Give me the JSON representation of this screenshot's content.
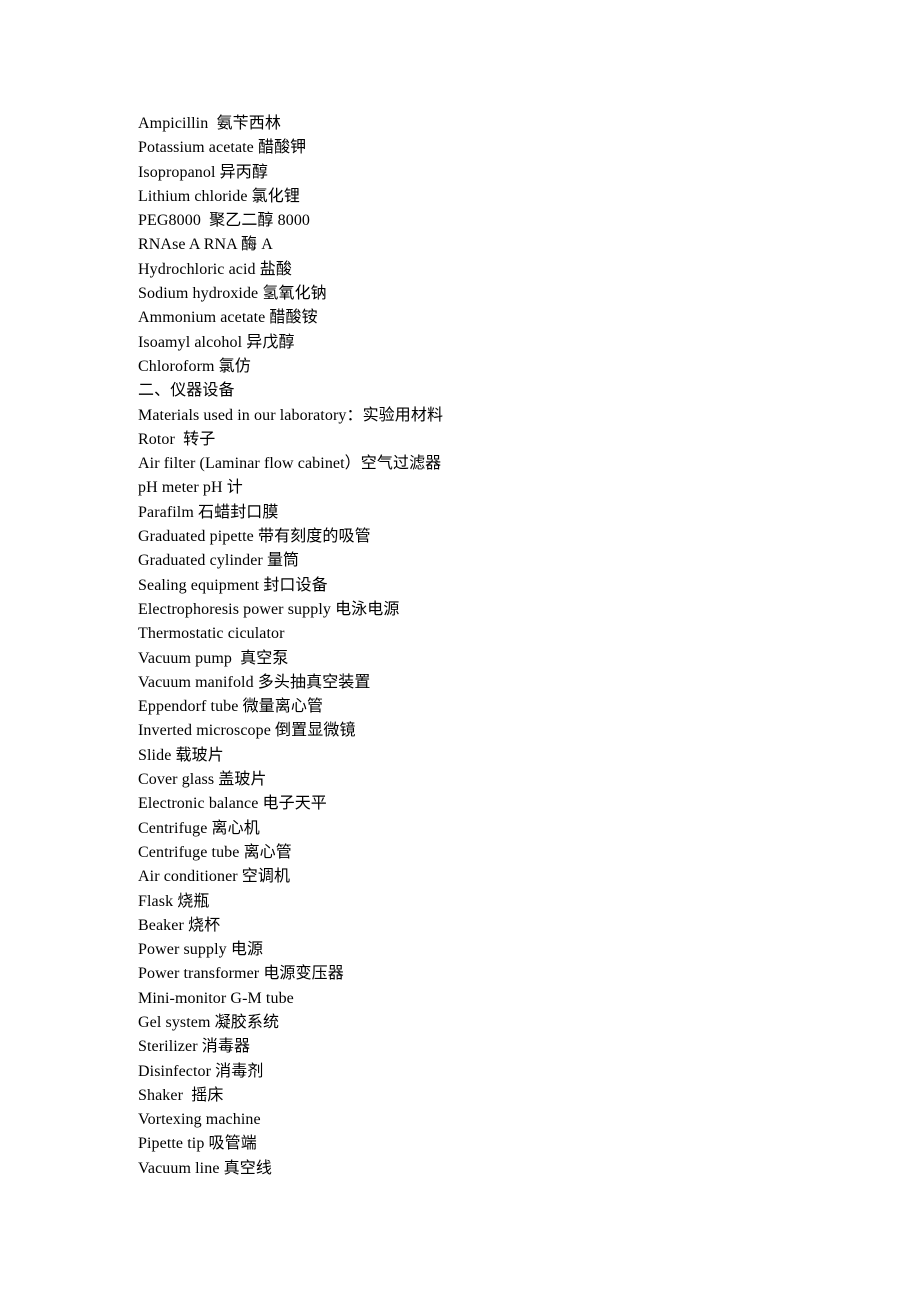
{
  "document": {
    "background_color": "#ffffff",
    "text_color": "#000000",
    "lines": [
      {
        "text": "Ampicillin  氨苄西林",
        "type": "entry"
      },
      {
        "text": "Potassium acetate 醋酸钾",
        "type": "entry"
      },
      {
        "text": "Isopropanol 异丙醇",
        "type": "entry"
      },
      {
        "text": "Lithium chloride 氯化锂",
        "type": "entry"
      },
      {
        "text": "PEG8000  聚乙二醇 8000",
        "type": "entry"
      },
      {
        "text": "RNAse A RNA 酶 A",
        "type": "entry"
      },
      {
        "text": "Hydrochloric acid 盐酸",
        "type": "entry"
      },
      {
        "text": "Sodium hydroxide 氢氧化钠",
        "type": "entry"
      },
      {
        "text": "Ammonium acetate 醋酸铵",
        "type": "entry"
      },
      {
        "text": "Isoamyl alcohol 异戊醇",
        "type": "entry"
      },
      {
        "text": "Chloroform 氯仿",
        "type": "entry"
      },
      {
        "text": "二、仪器设备",
        "type": "heading"
      },
      {
        "text": "Materials used in our laboratory：实验用材料",
        "type": "entry"
      },
      {
        "text": "Rotor  转子",
        "type": "entry"
      },
      {
        "text": "Air filter (Laminar flow cabinet）空气过滤器",
        "type": "entry"
      },
      {
        "text": "pH meter pH 计",
        "type": "entry"
      },
      {
        "text": "Parafilm 石蜡封口膜",
        "type": "entry"
      },
      {
        "text": "Graduated pipette 带有刻度的吸管",
        "type": "entry"
      },
      {
        "text": "Graduated cylinder 量筒",
        "type": "entry"
      },
      {
        "text": "Sealing equipment 封口设备",
        "type": "entry"
      },
      {
        "text": "Electrophoresis power supply 电泳电源",
        "type": "entry"
      },
      {
        "text": "Thermostatic ciculator",
        "type": "entry"
      },
      {
        "text": "Vacuum pump  真空泵",
        "type": "entry"
      },
      {
        "text": "Vacuum manifold 多头抽真空装置",
        "type": "entry"
      },
      {
        "text": "Eppendorf tube 微量离心管",
        "type": "entry"
      },
      {
        "text": "Inverted microscope 倒置显微镜",
        "type": "entry"
      },
      {
        "text": "Slide 载玻片",
        "type": "entry"
      },
      {
        "text": "Cover glass 盖玻片",
        "type": "entry"
      },
      {
        "text": "Electronic balance 电子天平",
        "type": "entry"
      },
      {
        "text": "Centrifuge 离心机",
        "type": "entry"
      },
      {
        "text": "Centrifuge tube 离心管",
        "type": "entry"
      },
      {
        "text": "Air conditioner 空调机",
        "type": "entry"
      },
      {
        "text": "Flask 烧瓶",
        "type": "entry"
      },
      {
        "text": "Beaker 烧杯",
        "type": "entry"
      },
      {
        "text": "Power supply 电源",
        "type": "entry"
      },
      {
        "text": "Power transformer 电源变压器",
        "type": "entry"
      },
      {
        "text": "Mini-monitor G-M tube",
        "type": "entry"
      },
      {
        "text": "Gel system 凝胶系统",
        "type": "entry"
      },
      {
        "text": "Sterilizer 消毒器",
        "type": "entry"
      },
      {
        "text": "Disinfector 消毒剂",
        "type": "entry"
      },
      {
        "text": "Shaker  摇床",
        "type": "entry"
      },
      {
        "text": "Vortexing machine",
        "type": "entry"
      },
      {
        "text": "Pipette tip 吸管端",
        "type": "entry"
      },
      {
        "text": "Vacuum line 真空线",
        "type": "entry"
      }
    ]
  }
}
